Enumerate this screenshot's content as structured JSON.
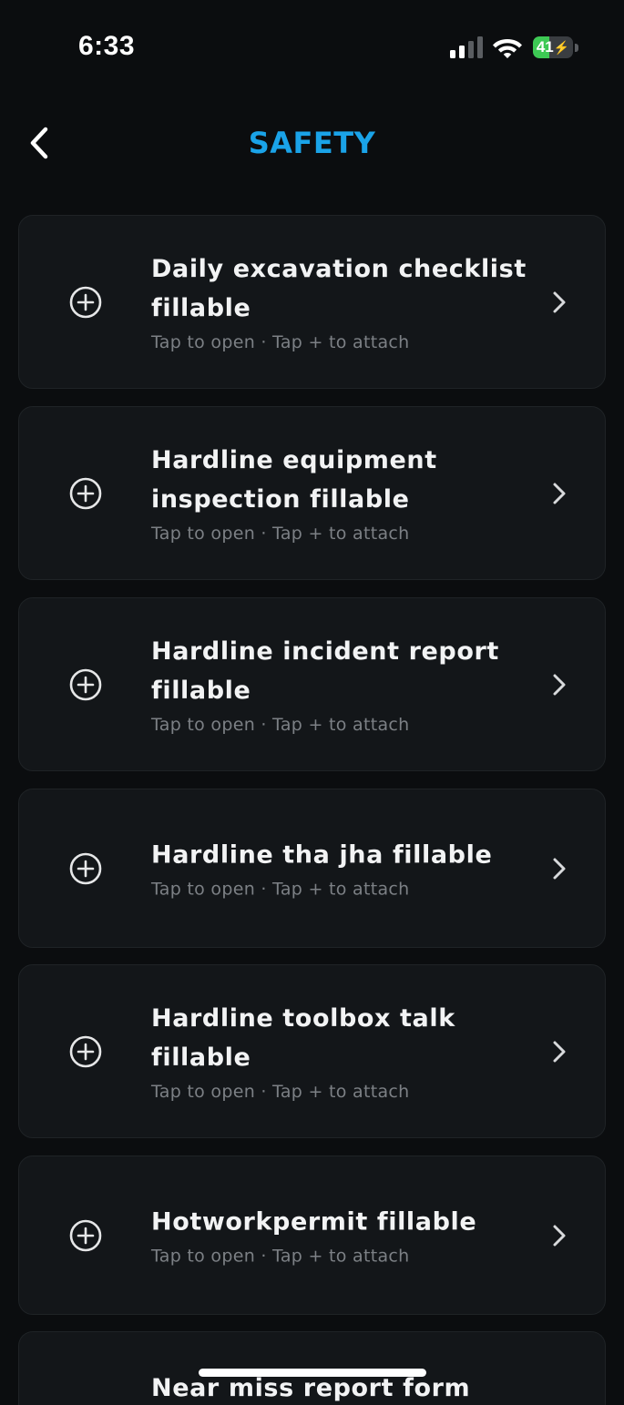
{
  "status_bar": {
    "time": "6:33",
    "battery_level": "41",
    "battery_percent": 41,
    "battery_color": "#3dc954"
  },
  "header": {
    "title": "SAFETY",
    "title_color": "#1aa3e8",
    "back_icon": "chevron-left-icon"
  },
  "items": [
    {
      "title": "Daily excavation checklist fillable",
      "subtitle": "Tap to open · Tap + to attach"
    },
    {
      "title": "Hardline equipment inspection fillable",
      "subtitle": "Tap to open · Tap + to attach"
    },
    {
      "title": "Hardline incident report fillable",
      "subtitle": "Tap to open · Tap + to attach"
    },
    {
      "title": "Hardline tha jha fillable",
      "subtitle": "Tap to open · Tap + to attach"
    },
    {
      "title": "Hardline toolbox talk fillable",
      "subtitle": "Tap to open · Tap + to attach"
    },
    {
      "title": "Hotworkpermit fillable",
      "subtitle": "Tap to open · Tap + to attach"
    },
    {
      "title": "Near miss report form",
      "subtitle": ""
    }
  ],
  "icons": {
    "add": "plus-circle-icon",
    "open": "chevron-right-icon"
  }
}
